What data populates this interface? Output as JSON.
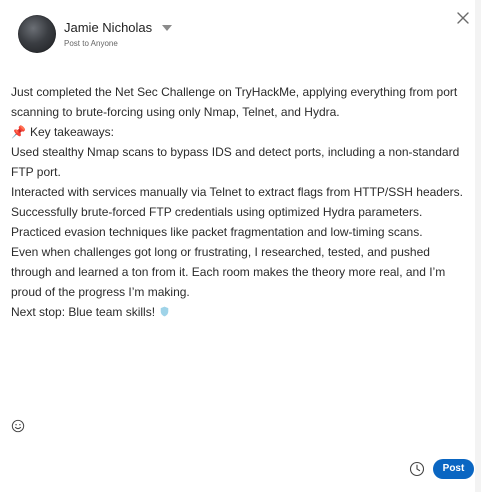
{
  "author": {
    "name": "Jamie Nicholas",
    "visibility": "Post to Anyone"
  },
  "post": {
    "intro": "Just completed the Net Sec Challenge on TryHackMe, applying everything from port scanning to brute-forcing using only Nmap, Telnet, and Hydra.",
    "takeaways_pin": "📌",
    "takeaways_label": "Key takeaways:",
    "line1": "Used stealthy Nmap scans to bypass IDS and detect ports, including a non-standard FTP port.",
    "line2": "Interacted with services manually via Telnet to extract flags from HTTP/SSH headers.",
    "line3": "Successfully brute-forced FTP credentials using optimized Hydra parameters.",
    "line4": "Practiced evasion techniques like packet fragmentation and low-timing scans.",
    "line5": "Even when challenges got long or frustrating, I researched, tested, and pushed through and learned a ton from it. Each room makes the theory more real, and I’m proud of the progress I’m making.",
    "next_step": "Next stop: Blue team skills!"
  },
  "actions": {
    "post_label": "Post"
  },
  "icons": {
    "close": "close-icon",
    "emoji": "smiley-icon",
    "shield": "shield-icon",
    "caret": "caret-down-icon",
    "pin": "pushpin-icon"
  },
  "colors": {
    "primary": "#0a66c2",
    "pin": "#e0518b",
    "shield": "#9fd3e8"
  }
}
